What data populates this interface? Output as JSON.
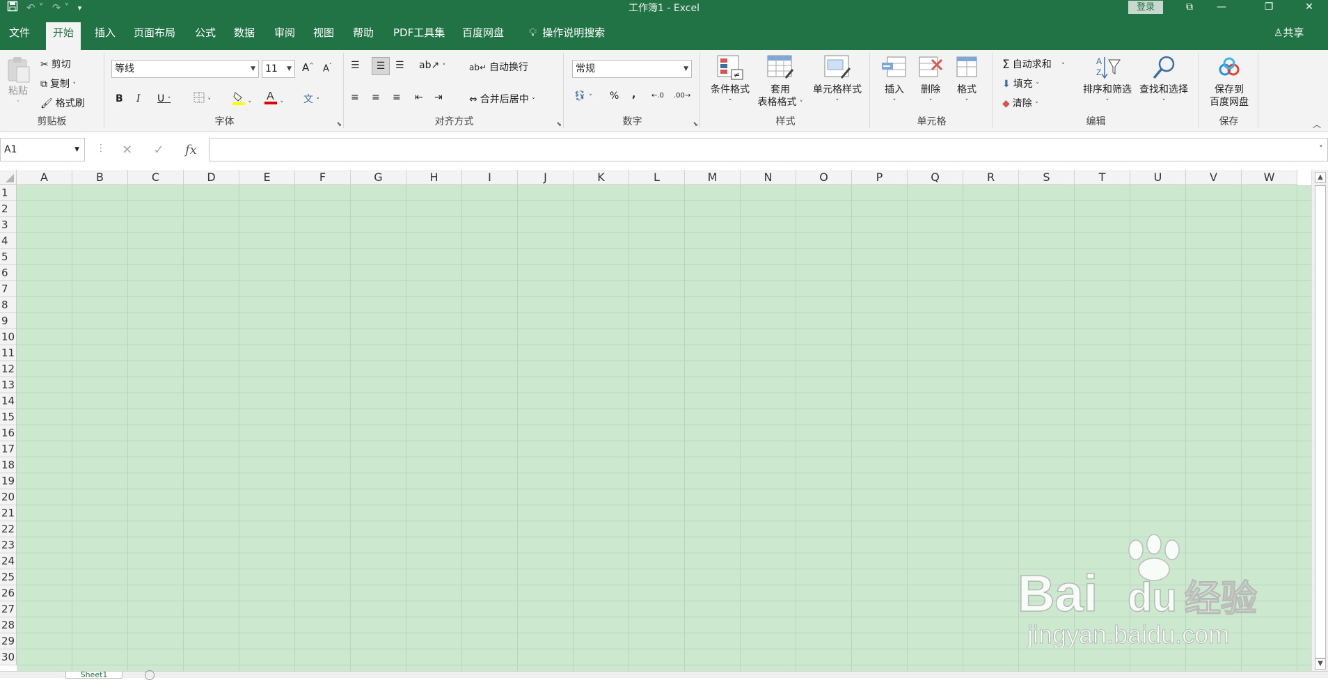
{
  "titlebar": {
    "title": "工作簿1  -  Excel",
    "login": "登录",
    "qat": [
      "save-icon",
      "undo-icon",
      "redo-icon",
      "customize-icon"
    ]
  },
  "tabs": [
    {
      "label": "文件"
    },
    {
      "label": "开始",
      "active": true
    },
    {
      "label": "插入"
    },
    {
      "label": "页面布局"
    },
    {
      "label": "公式"
    },
    {
      "label": "数据"
    },
    {
      "label": "审阅"
    },
    {
      "label": "视图"
    },
    {
      "label": "帮助"
    },
    {
      "label": "PDF工具集"
    },
    {
      "label": "百度网盘"
    }
  ],
  "tellme": "操作说明搜索",
  "share": "共享",
  "ribbon": {
    "clipboard": {
      "label": "剪贴板",
      "paste": "粘贴",
      "cut": "剪切",
      "copy": "复制",
      "format_painter": "格式刷"
    },
    "font": {
      "label": "字体",
      "font_name": "等线",
      "font_size": "11",
      "bold": "B",
      "italic": "I",
      "underline": "U",
      "grow": "A",
      "shrink": "A",
      "phonetic": "文"
    },
    "alignment": {
      "label": "对齐方式",
      "wrap": "自动换行",
      "merge": "合并后居中"
    },
    "number": {
      "label": "数字",
      "format": "常规",
      "percent": "%",
      "comma": ","
    },
    "styles": {
      "label": "样式",
      "conditional": "条件格式",
      "table_line1": "套用",
      "table_line2": "表格格式",
      "cell_styles": "单元格样式"
    },
    "cells": {
      "label": "单元格",
      "insert": "插入",
      "delete": "删除",
      "format": "格式"
    },
    "editing": {
      "label": "编辑",
      "autosum": "自动求和",
      "fill": "填充",
      "clear": "清除",
      "sort": "排序和筛选",
      "find": "查找和选择"
    },
    "save": {
      "label": "保存",
      "line1": "保存到",
      "line2": "百度网盘"
    }
  },
  "formula_bar": {
    "namebox": "A1",
    "fx": "fx",
    "formula": ""
  },
  "columns": [
    "A",
    "B",
    "C",
    "D",
    "E",
    "F",
    "G",
    "H",
    "I",
    "J",
    "K",
    "L",
    "M",
    "N",
    "O",
    "P",
    "Q",
    "R",
    "S",
    "T",
    "U",
    "V",
    "W"
  ],
  "rows": [
    "1",
    "2",
    "3",
    "4",
    "5",
    "6",
    "7",
    "8",
    "9",
    "10",
    "11",
    "12",
    "13",
    "14",
    "15",
    "16",
    "17",
    "18",
    "19",
    "20",
    "21",
    "22",
    "23",
    "24",
    "25",
    "26",
    "27",
    "28",
    "29",
    "30"
  ],
  "sheet": {
    "tab": "Sheet1"
  },
  "watermark": {
    "brand": "Bai",
    "brand2": "du",
    "cn": "经验",
    "url": "jingyan.baidu.com"
  },
  "colors": {
    "accent": "#217346",
    "cell_bg": "#cce8cf"
  }
}
